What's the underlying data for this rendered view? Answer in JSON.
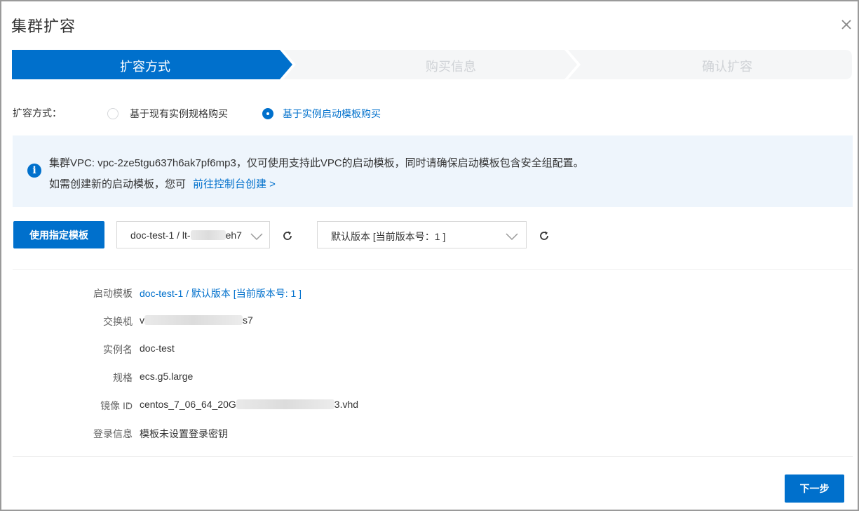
{
  "dialog": {
    "title": "集群扩容",
    "close_icon": "close-icon"
  },
  "steps": [
    {
      "label": "扩容方式",
      "state": "active"
    },
    {
      "label": "购买信息",
      "state": "inactive"
    },
    {
      "label": "确认扩容",
      "state": "inactive"
    }
  ],
  "mode": {
    "label": "扩容方式：",
    "options": [
      {
        "label": "基于现有实例规格购买",
        "selected": false
      },
      {
        "label": "基于实例启动模板购买",
        "selected": true
      }
    ]
  },
  "info": {
    "icon": "info-icon",
    "line1": "集群VPC: vpc-2ze5tgu637h6ak7pf6mp3，仅可使用支持此VPC的启动模板，同时请确保启动模板包含安全组配置。",
    "line2": "如需创建新的启动模板，您可",
    "link": "前往控制台创建 >"
  },
  "template": {
    "button": "使用指定模板",
    "template_select": {
      "prefix": "doc-test-1 / lt-",
      "suffix": "eh7"
    },
    "version_select": "默认版本 [当前版本号：1 ]",
    "refresh_icon": "refresh-icon",
    "chevron_icon": "chevron-down-icon"
  },
  "details": [
    {
      "key": "启动模板",
      "value": "doc-test-1 / 默认版本 [当前版本号: 1 ]",
      "link": true
    },
    {
      "key": "交换机",
      "prefix": "v",
      "suffix": "s7",
      "link": false
    },
    {
      "key": "实例名",
      "value": "doc-test",
      "link": false
    },
    {
      "key": "规格",
      "value": "ecs.g5.large",
      "link": false
    },
    {
      "key": "镜像 ID",
      "prefix": "centos_7_06_64_20G",
      "suffix": "3.vhd",
      "link": false
    },
    {
      "key": "登录信息",
      "value": "模板未设置登录密钥",
      "link": false
    }
  ],
  "footer": {
    "next_button": "下一步"
  },
  "colors": {
    "primary": "#0070cc",
    "step_inactive_bg": "#f5f6f7",
    "info_bg": "#eef5fc"
  }
}
